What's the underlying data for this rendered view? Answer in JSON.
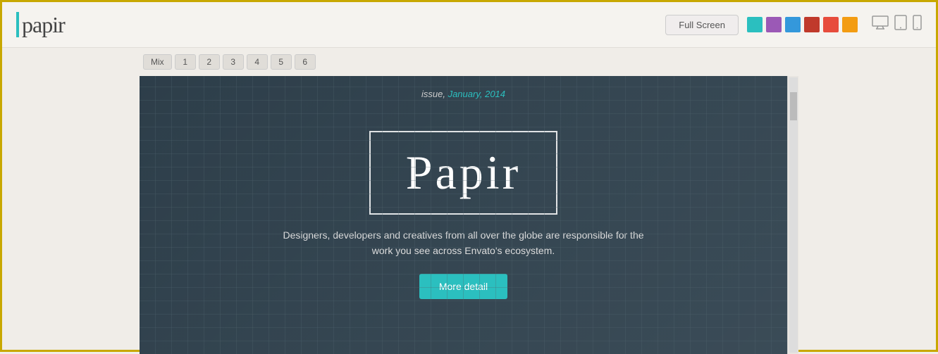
{
  "header": {
    "logo_bar": "|",
    "logo_text": "papir",
    "fullscreen_label": "Full Screen"
  },
  "swatches": [
    {
      "color": "#2bbfbf",
      "name": "teal"
    },
    {
      "color": "#9b59b6",
      "name": "purple"
    },
    {
      "color": "#3498db",
      "name": "blue"
    },
    {
      "color": "#c0392b",
      "name": "dark-red"
    },
    {
      "color": "#e74c3c",
      "name": "red"
    },
    {
      "color": "#f39c12",
      "name": "orange"
    }
  ],
  "devices": [
    "desktop",
    "tablet",
    "mobile"
  ],
  "tabs": {
    "mix_label": "Mix",
    "items": [
      "1",
      "2",
      "3",
      "4",
      "5",
      "6"
    ]
  },
  "hero": {
    "issue_label": "issue,",
    "issue_date": " January, 2014",
    "title": "Papir",
    "subtitle": "Designers, developers and creatives from all over the globe are responsible for the work you see across Envato's ecosystem.",
    "cta_label": "More detail"
  }
}
